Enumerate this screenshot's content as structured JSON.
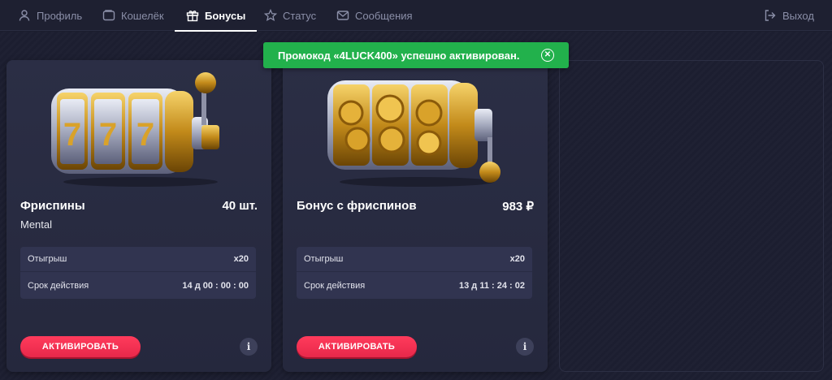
{
  "nav": {
    "items": [
      {
        "label": "Профиль",
        "icon": "user-icon",
        "active": false
      },
      {
        "label": "Кошелёк",
        "icon": "wallet-icon",
        "active": false
      },
      {
        "label": "Бонусы",
        "icon": "gift-icon",
        "active": true
      },
      {
        "label": "Статус",
        "icon": "star-icon",
        "active": false
      },
      {
        "label": "Сообщения",
        "icon": "mail-icon",
        "active": false
      }
    ],
    "logout": {
      "label": "Выход",
      "icon": "logout-icon"
    }
  },
  "toast": {
    "message": "Промокод «4LUCK400» успешно активирован.",
    "close_icon": "close-icon",
    "color": "#22b14c"
  },
  "cards": [
    {
      "title": "Фриспины",
      "amount": "40 шт.",
      "subtitle": "Mental",
      "image_icon": "slot-machine-777-icon",
      "rows": [
        {
          "label": "Отыгрыш",
          "value": "x20"
        },
        {
          "label": "Срок действия",
          "value": "14 д 00 : 00 : 00"
        }
      ],
      "button_label": "АКТИВИРОВАТЬ",
      "info_label": "i"
    },
    {
      "title": "Бонус с фриспинов",
      "amount": "983 ₽",
      "subtitle": "",
      "image_icon": "slot-machine-coins-icon",
      "rows": [
        {
          "label": "Отыгрыш",
          "value": "x20"
        },
        {
          "label": "Срок действия",
          "value": "13 д 11 : 24 : 02"
        }
      ],
      "button_label": "АКТИВИРОВАТЬ",
      "info_label": "i"
    }
  ],
  "colors": {
    "accent": "#ff3b5c",
    "success": "#22b14c",
    "background": "#1b1d2e",
    "card": "#2b2e45"
  }
}
